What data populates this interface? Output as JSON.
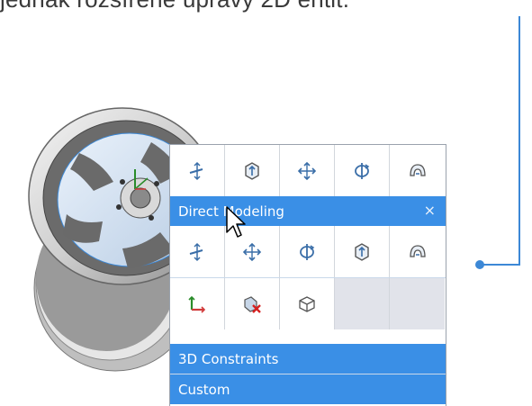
{
  "caption": {
    "text": "jednak rozšířené úpravy 2D entit."
  },
  "panel": {
    "top_icons": [
      {
        "icon": "align-move-icon"
      },
      {
        "icon": "box-extrude-icon"
      },
      {
        "icon": "move-arrows-icon"
      },
      {
        "icon": "rotate-icon"
      },
      {
        "icon": "shell-icon"
      }
    ],
    "direct_modeling": {
      "title": "Direct Modeling",
      "close_label": "×",
      "row1": [
        {
          "icon": "align-move-icon"
        },
        {
          "icon": "move-arrows-icon"
        },
        {
          "icon": "rotate-icon"
        },
        {
          "icon": "box-extrude-icon"
        },
        {
          "icon": "shell-icon"
        }
      ],
      "row2": [
        {
          "icon": "axes-icon"
        },
        {
          "icon": "delete-face-icon"
        },
        {
          "icon": "wire-box-icon"
        }
      ]
    },
    "constraints_title": "3D Constraints",
    "custom_title": "Custom"
  },
  "colors": {
    "accent": "#3a8fe6",
    "connector": "#3c88d6"
  }
}
